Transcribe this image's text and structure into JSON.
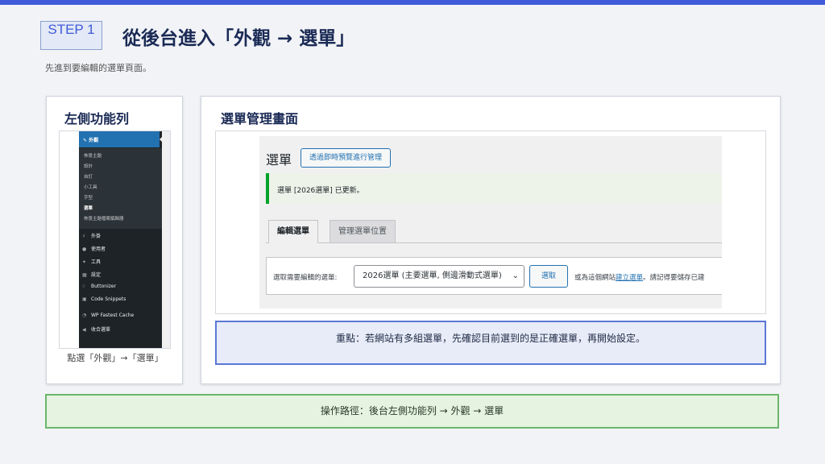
{
  "header": {
    "step_badge": "STEP 1",
    "title": "從後台進入「外觀 → 選單」",
    "subtitle": "先進到要編輯的選單頁面。"
  },
  "left_card": {
    "title": "左側功能列",
    "caption": "點選「外觀」→「選單」",
    "sidebar": {
      "active_item": "外觀",
      "submenu": [
        "佈景主題",
        "設計",
        "自訂",
        "小工具",
        "字型",
        "選單",
        "佈景主題檔案編輯器"
      ],
      "current_submenu": "選單",
      "items": [
        {
          "label": "外掛",
          "icon": "plugin-icon"
        },
        {
          "label": "使用者",
          "icon": "user-icon"
        },
        {
          "label": "工具",
          "icon": "wrench-icon"
        },
        {
          "label": "設定",
          "icon": "settings-icon"
        },
        {
          "label": "Buttonizer",
          "icon": "buttonizer-icon"
        },
        {
          "label": "Code Snippets",
          "icon": "code-icon"
        },
        {
          "label": "WP Fastest Cache",
          "icon": "cache-icon"
        },
        {
          "label": "收合選單",
          "icon": "collapse-icon"
        }
      ]
    }
  },
  "right_card": {
    "title": "選單管理畫面",
    "wp": {
      "page_heading": "選單",
      "live_preview_button": "透過即時預覽進行管理",
      "notice": "選單 [2026選單] 已更新。",
      "tabs": [
        "編輯選單",
        "管理選單位置"
      ],
      "select_label": "選取需要編輯的選單:",
      "select_value": "2026選單 (主要選單, 側邊滑動式選單)",
      "select_button": "選取",
      "or_text_before": "或為這個網站",
      "or_link": "建立選單",
      "or_text_after": "。請記得要儲存已建"
    },
    "note": "重點：若網站有多組選單，先確認目前選到的是正確選單，再開始設定。"
  },
  "footer": {
    "path": "操作路徑：後台左側功能列 → 外觀 → 選單"
  },
  "colors": {
    "accent": "#3f5bd9",
    "wp_sidebar": "#1d2327",
    "wp_active": "#2271b1",
    "success_green": "#00a32a",
    "note_border": "#5a77d6",
    "path_border": "#6cb56c"
  }
}
